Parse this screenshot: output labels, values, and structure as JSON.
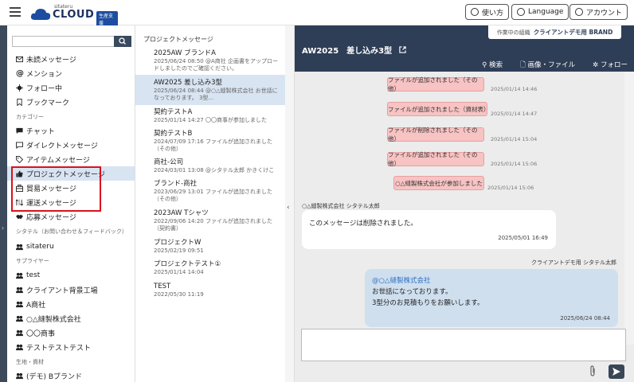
{
  "header": {
    "logo_small": "sitateru",
    "logo_text": "CLOUD",
    "logo_badge": "生産支援",
    "help_label": "使い方",
    "language_label": "Language",
    "account_label": "アカウント"
  },
  "sidebar": {
    "items": [
      {
        "label": "未読メッセージ",
        "icon": "mail-icon"
      },
      {
        "label": "メンション",
        "icon": "at-icon"
      },
      {
        "label": "フォロー中",
        "icon": "follow-icon"
      },
      {
        "label": "ブックマーク",
        "icon": "bookmark-icon"
      }
    ],
    "category_label": "カテゴリー",
    "category_items": [
      {
        "label": "チャット",
        "icon": "chat-icon"
      },
      {
        "label": "ダイレクトメッセージ",
        "icon": "direct-message-icon"
      },
      {
        "label": "アイテムメッセージ",
        "icon": "tag-icon"
      },
      {
        "label": "プロジェクトメッセージ",
        "icon": "thumbs-up-icon"
      },
      {
        "label": "貿易メッセージ",
        "icon": "briefcase-icon"
      },
      {
        "label": "運送メッセージ",
        "icon": "shipping-icon"
      },
      {
        "label": "応募メッセージ",
        "icon": "handshake-icon"
      }
    ],
    "sitateru_label": "シタテル（お問い合わせ＆フィードバック）",
    "sitateru_items": [
      {
        "label": "sitateru"
      }
    ],
    "supplier_label": "サプライヤー",
    "supplier_items": [
      {
        "label": "test"
      },
      {
        "label": "クライアント背景工場"
      },
      {
        "label": "A商社"
      },
      {
        "label": "○△縫製株式会社"
      },
      {
        "label": "〇〇商事"
      },
      {
        "label": "テストテストテスト"
      }
    ],
    "material_label": "生地・資材",
    "material_items": [
      {
        "label": "(デモ) Bブランド"
      }
    ]
  },
  "message_list": {
    "title": "プロジェクトメッセージ",
    "items": [
      {
        "title": "2025AW ブランドA",
        "detail1": "2025/06/24 08:50  @A商社 企画書をアップロー",
        "detail2": "ドしましたのでご確認ください。"
      },
      {
        "title": "AW2025 差し込み3型",
        "detail1": "2025/06/24 08:44  @○△縫製株式会社 お世話に",
        "detail2": "なっております。 3型…"
      },
      {
        "title": "契約テストA",
        "detail1": "2025/01/14 14:27  〇〇商事が参加しました",
        "detail2": ""
      },
      {
        "title": "契約テストB",
        "detail1": "2024/07/09 17:16  ファイルが追加されました",
        "detail2": "（その他）"
      },
      {
        "title": "商社-公司",
        "detail1": "2024/03/01 13:08  @シタテル太郎 かきくけこ",
        "detail2": ""
      },
      {
        "title": "ブランド-商社",
        "detail1": "2023/06/29 13:01  ファイルが追加されました",
        "detail2": "（その他）"
      },
      {
        "title": "2023AW Tシャツ",
        "detail1": "2022/09/06 14:20  ファイルが追加されました",
        "detail2": "（契約書）"
      },
      {
        "title": "プロジェクトW",
        "detail1": "2025/02/19 09:51",
        "detail2": ""
      },
      {
        "title": "プロジェクトテスト①",
        "detail1": "2025/01/14 14:04",
        "detail2": ""
      },
      {
        "title": "TEST",
        "detail1": "2022/05/30 11:19",
        "detail2": ""
      }
    ]
  },
  "chat": {
    "org_label": "作業中の組織",
    "org_name": "クライアントデモ用 BRAND",
    "title": "AW2025　差し込み3型",
    "tool_search": "検索",
    "tool_files": "画像・ファイル",
    "tool_follow": "フォロー",
    "system_messages": [
      {
        "text": "ファイルが追加されました（その他）",
        "time": "2025/01/14 14:46"
      },
      {
        "text": "ファイルが追加されました（資材表）",
        "time": "2025/01/14 14:47"
      },
      {
        "text": "ファイルが削除されました（その他）",
        "time": "2025/01/14 15:04"
      },
      {
        "text": "ファイルが追加されました（その他）",
        "time": "2025/01/14 15:06"
      },
      {
        "text": "○△縫製株式会社が参加しました",
        "time": "2025/01/14 15:06"
      }
    ],
    "left_sender": "○△縫製株式会社 シタテル太郎",
    "left_text": "このメッセージは削除されました。",
    "left_time": "2025/05/01 16:49",
    "right_sender": "クライアントデモ用 シタテル太郎",
    "right_mention": "@○△縫製株式会社",
    "right_line1": "お世話になっております。",
    "right_line2": "3型分のお見積もりをお願いします。",
    "right_time": "2025/06/24 08:44"
  }
}
